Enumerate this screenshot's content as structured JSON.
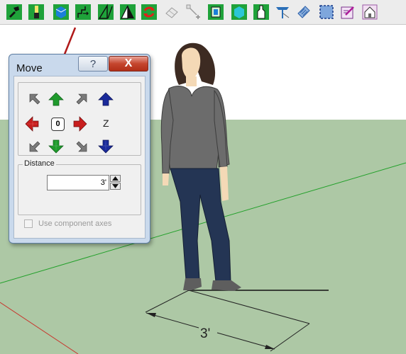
{
  "toolbar": {
    "items": [
      "paint-tool-icon",
      "brush-tool-icon",
      "cube-tool-icon",
      "move-stairs-icon",
      "triangle-left-icon",
      "triangle-right-icon",
      "rotate-icon",
      "eraser-icon",
      "scale-icon",
      "green-frame-icon",
      "cyan-box-icon",
      "bottle-icon",
      "tape-icon",
      "hatch-icon",
      "selection-icon",
      "edit-note-icon",
      "house-icon"
    ]
  },
  "move_dialog": {
    "title": "Move",
    "help_label": "?",
    "close_label": "X",
    "center_label": "0",
    "z_label": "Z",
    "distance_legend": "Distance",
    "distance_value": "3'",
    "use_component_axes": "Use component axes",
    "use_component_checked": false
  },
  "scene": {
    "dimension_label": "3'"
  },
  "colors": {
    "sky": "#ffffff",
    "ground": "#adc8a5",
    "green_axis": "#22a02a",
    "red_axis": "#c8342c",
    "arrow_green": "#1f9a2c",
    "arrow_red": "#c81e1e",
    "arrow_blue": "#1a2a9a"
  }
}
